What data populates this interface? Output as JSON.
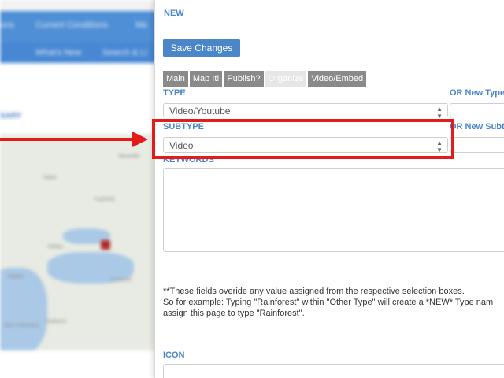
{
  "background": {
    "nav_top": [
      "ons",
      "Current Conditions",
      "Me"
    ],
    "nav_bottom": [
      "What's New",
      "Search & Li"
    ],
    "side_link": "SARY",
    "map_labels": [
      "Napa",
      "Vacaville",
      "Fairfield",
      "Vallejo",
      "Concord",
      "Rafael",
      "San Francisco",
      "Oakland"
    ]
  },
  "modal": {
    "title": "NEW",
    "save_label": "Save Changes",
    "tabs": [
      "Main",
      "Map It!",
      "Publish?",
      "Organize",
      "Video/Embed"
    ],
    "active_tab": "Organize",
    "type_label": "TYPE",
    "type_value": "Video/Youtube",
    "or_new_type_label": "OR New Type",
    "subtype_label": "SUBTYPE",
    "subtype_value": "Video",
    "or_new_subtype_label": "OR New Subt",
    "keywords_label": "KEYWORDS",
    "note_line1": "**These fields overide any value assigned from the respective selection boxes.",
    "note_line2": "So for example: Typing \"Rainforest\" within \"Other Type\" will create a *NEW* Type nam",
    "note_line3": "assign this page to type \"Rainforest\".",
    "icon_label": "ICON"
  },
  "colors": {
    "accent": "#4a86c8",
    "annotation": "#e31b1b",
    "tab_inactive": "#8a8a8a"
  }
}
